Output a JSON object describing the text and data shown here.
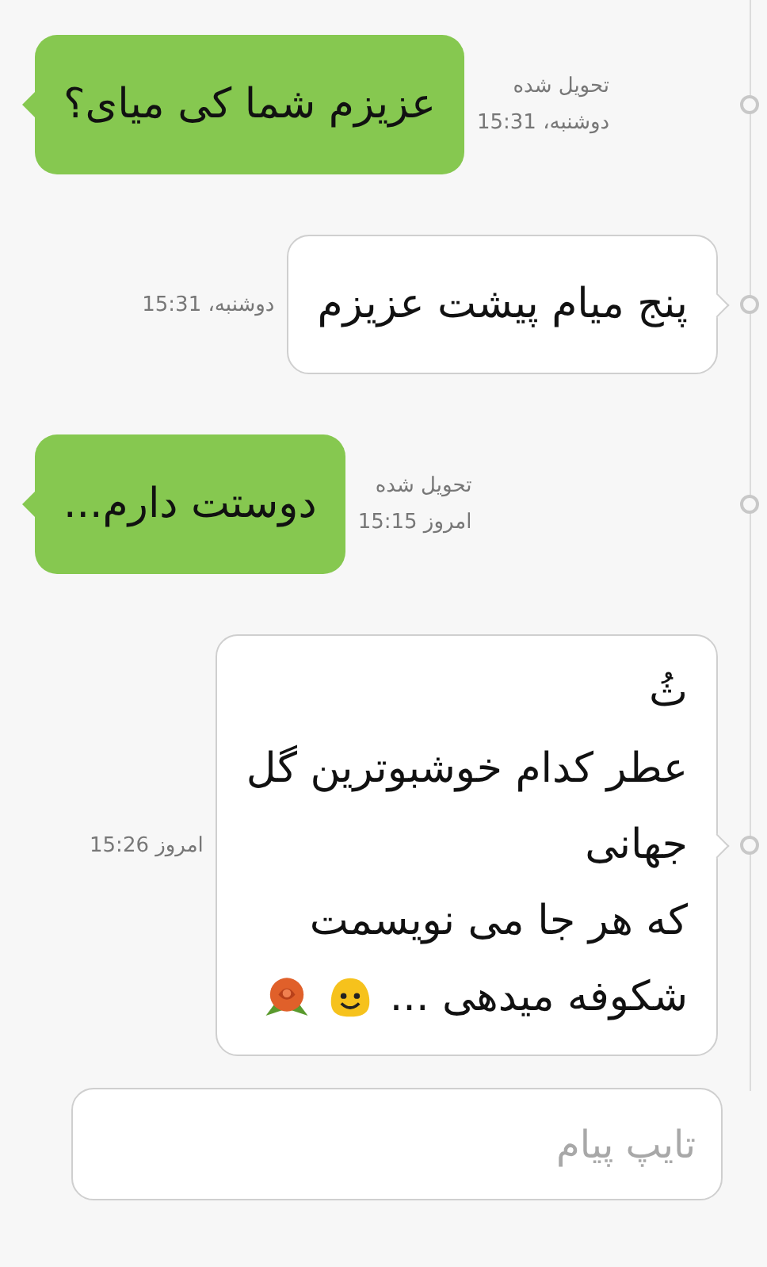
{
  "messages": [
    {
      "kind": "sent",
      "lines": [
        "عزیزم شما کی میای؟"
      ],
      "status": "تحویل شده",
      "time": "دوشنبه، 15:31"
    },
    {
      "kind": "received",
      "lines": [
        "پنج میام پیشت عزیزم"
      ],
      "time": "دوشنبه، 15:31"
    },
    {
      "kind": "sent",
      "lines": [
        "دوستت دارم..."
      ],
      "status": "تحویل شده",
      "time": "امروز 15:15"
    },
    {
      "kind": "received",
      "lines": [
        "ثُ",
        "عطر کدام خوشبوترین گل",
        "جهانی",
        "که هر جا می نویسمت",
        "شکوفه میدهی ..."
      ],
      "emoji": [
        {
          "kind": "smiley"
        },
        {
          "kind": "rose"
        }
      ],
      "time": "امروز 15:26"
    }
  ],
  "composer": {
    "placeholder": "تایپ پیام"
  }
}
